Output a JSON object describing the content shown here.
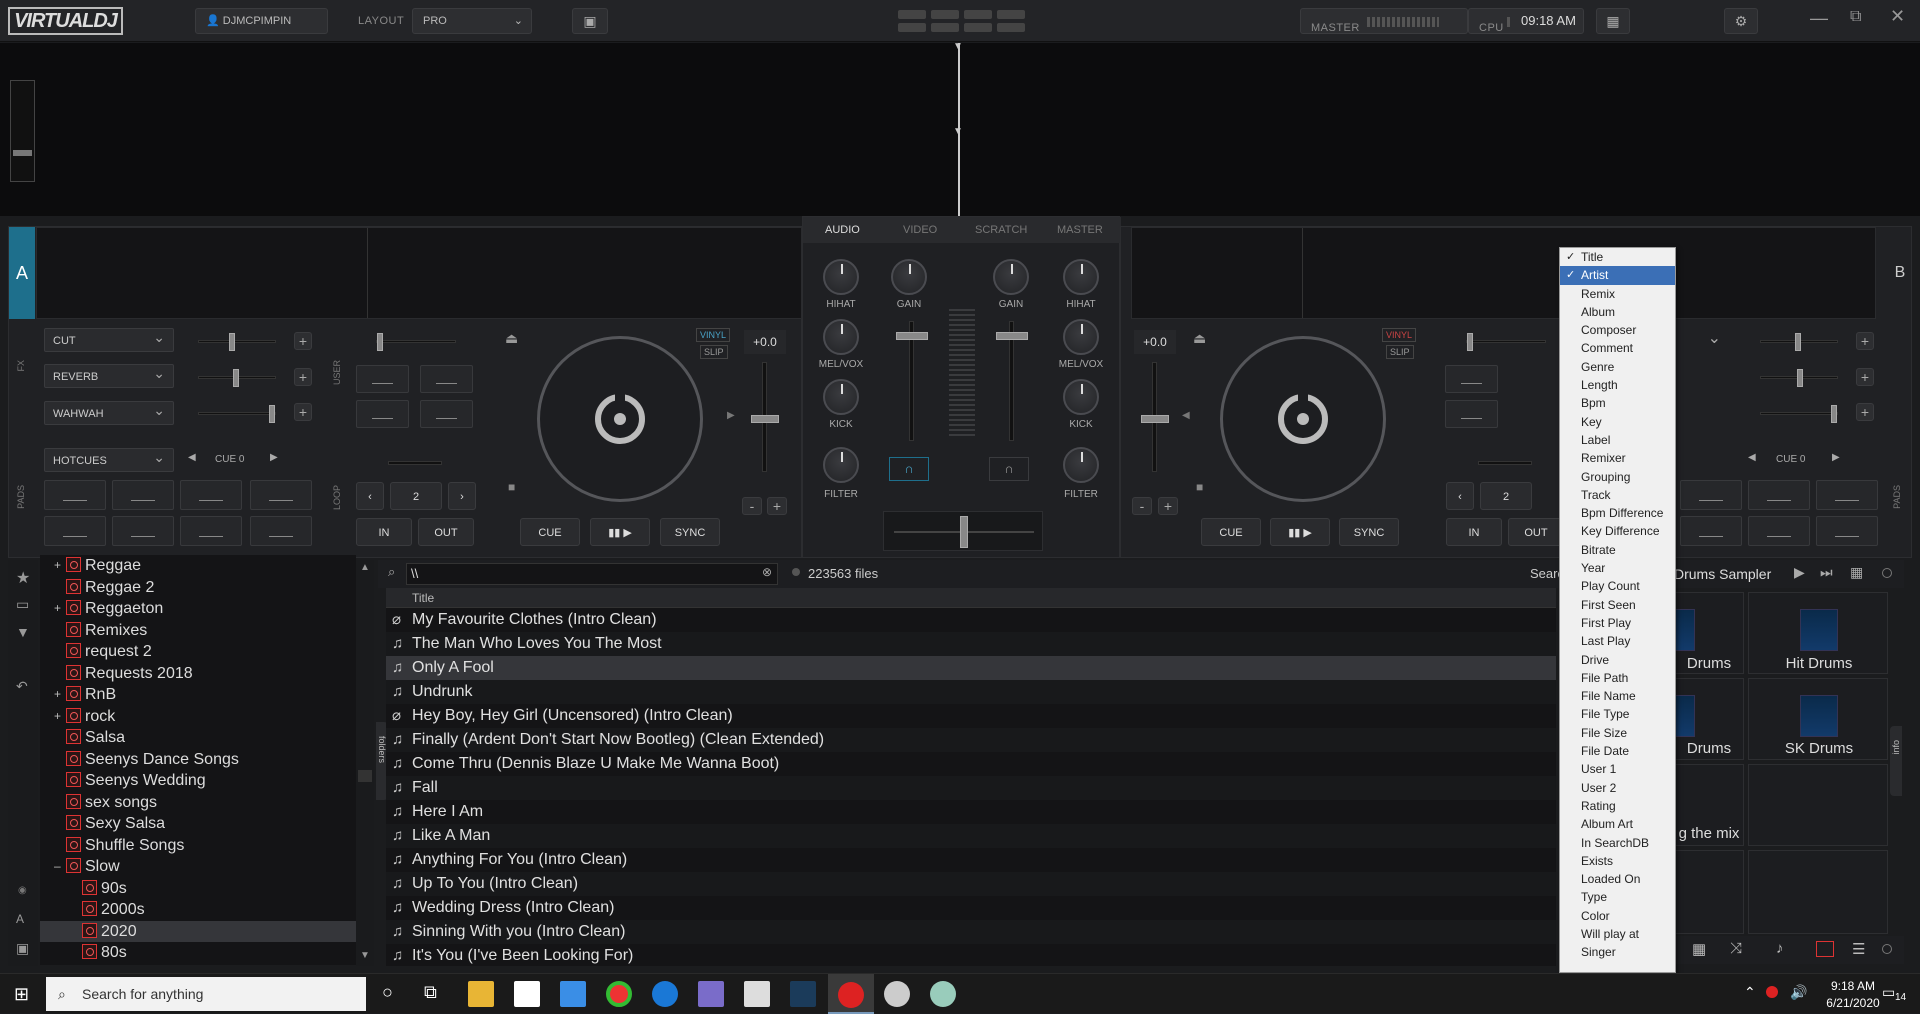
{
  "app": {
    "logo": "VIRTUALDJ",
    "user": "DJMCPIMPIN",
    "layout_label": "LAYOUT",
    "layout_value": "PRO",
    "master_label": "MASTER",
    "cpu_label": "CPU",
    "clock": "09:18 AM"
  },
  "mixer_tabs": [
    "AUDIO",
    "VIDEO",
    "SCRATCH",
    "MASTER"
  ],
  "deck_a": {
    "letter": "A",
    "fx": [
      "CUT",
      "REVERB",
      "WAHWAH"
    ],
    "pads_mode": "HOTCUES",
    "cue_label": "CUE 0",
    "pitch": "+0.0",
    "loop_value": "2",
    "in": "IN",
    "out": "OUT",
    "cue": "CUE",
    "play": "▮▮ ▶",
    "sync": "SYNC",
    "vinyl": "VINYL",
    "slip": "SLIP",
    "fx_side": "FX",
    "user_side": "USER",
    "pads_side": "PADS",
    "loop_side": "LOOP"
  },
  "deck_b": {
    "letter": "B",
    "cue_label": "CUE 0",
    "pitch": "+0.0",
    "loop_value": "2",
    "in": "IN",
    "out": "OUT",
    "cue": "CUE",
    "play": "▮▮ ▶",
    "sync": "SYNC",
    "vinyl": "VINYL",
    "slip": "SLIP",
    "pads_side": "PADS"
  },
  "mixer": {
    "hihat": "HIHAT",
    "gain": "GAIN",
    "melvox": "MEL/VOX",
    "kick": "KICK",
    "filter": "FILTER"
  },
  "search": {
    "query": "\\\\",
    "file_count": "223563 files",
    "status": "Searching",
    "column": "Title"
  },
  "tree": [
    {
      "label": "Reggae",
      "plus": true
    },
    {
      "label": "Reggae 2",
      "plus": false
    },
    {
      "label": "Reggaeton",
      "plus": true
    },
    {
      "label": "Remixes",
      "plus": false
    },
    {
      "label": "request 2",
      "plus": false
    },
    {
      "label": "Requests 2018",
      "plus": false
    },
    {
      "label": "RnB",
      "plus": true
    },
    {
      "label": "rock",
      "plus": true
    },
    {
      "label": "Salsa",
      "plus": false
    },
    {
      "label": "Seenys Dance Songs",
      "plus": false
    },
    {
      "label": "Seenys Wedding",
      "plus": false
    },
    {
      "label": "sex songs",
      "plus": false
    },
    {
      "label": "Sexy Salsa",
      "plus": false
    },
    {
      "label": "Shuffle Songs",
      "plus": false
    },
    {
      "label": "Slow",
      "plus": false,
      "minus": true
    },
    {
      "label": "90s",
      "plus": false,
      "indent": true
    },
    {
      "label": "2000s",
      "plus": false,
      "indent": true
    },
    {
      "label": "2020",
      "plus": false,
      "indent": true,
      "selected": true
    },
    {
      "label": "80s",
      "plus": false,
      "indent": true
    }
  ],
  "tracks": [
    "My Favourite Clothes (Intro Clean)",
    "The Man Who Loves You The Most",
    "Only A Fool",
    "Undrunk",
    "Hey Boy, Hey Girl (Uncensored) (Intro Clean)",
    "Finally (Ardent Don't Start Now Bootleg) (Clean Extended)",
    "Come Thru (Dennis Blaze U Make Me Wanna Boot)",
    "Fall",
    "Here I Am",
    "Like A Man",
    "Anything For You (Intro Clean)",
    "Up To You (Intro Clean)",
    "Wedding Dress (Intro Clean)",
    "Sinning With you (Intro Clean)",
    "It's You (I've Been Looking For)"
  ],
  "column_menu": [
    {
      "label": "Title",
      "checked": true
    },
    {
      "label": "Artist",
      "checked": true,
      "highlight": true
    },
    {
      "label": "Remix"
    },
    {
      "label": "Album"
    },
    {
      "label": "Composer"
    },
    {
      "label": "Comment"
    },
    {
      "label": "Genre"
    },
    {
      "label": "Length"
    },
    {
      "label": "Bpm"
    },
    {
      "label": "Key"
    },
    {
      "label": "Label"
    },
    {
      "label": "Remixer"
    },
    {
      "label": "Grouping"
    },
    {
      "label": "Track"
    },
    {
      "label": "Bpm Difference"
    },
    {
      "label": "Key Difference"
    },
    {
      "label": "Bitrate"
    },
    {
      "label": "Year"
    },
    {
      "label": "Play Count"
    },
    {
      "label": "First Seen"
    },
    {
      "label": "First Play"
    },
    {
      "label": "Last Play"
    },
    {
      "label": "Drive"
    },
    {
      "label": "File Path"
    },
    {
      "label": "File Name"
    },
    {
      "label": "File Type"
    },
    {
      "label": "File Size"
    },
    {
      "label": "File Date"
    },
    {
      "label": "User 1"
    },
    {
      "label": "User 2"
    },
    {
      "label": "Rating"
    },
    {
      "label": "Album Art"
    },
    {
      "label": "In SearchDB"
    },
    {
      "label": "Exists"
    },
    {
      "label": "Loaded On"
    },
    {
      "label": "Type"
    },
    {
      "label": "Color"
    },
    {
      "label": "Will play at"
    },
    {
      "label": "Singer"
    }
  ],
  "sampler": {
    "title": "Drums Sampler",
    "side": "info",
    "cells": [
      "Drums",
      "Hit Drums",
      "Drums",
      "SK Drums",
      "g the mix"
    ]
  },
  "sidebar_side": "folders",
  "taskbar": {
    "search": "Search for anything",
    "time": "9:18 AM",
    "date": "6/21/2020",
    "notif": "14"
  }
}
